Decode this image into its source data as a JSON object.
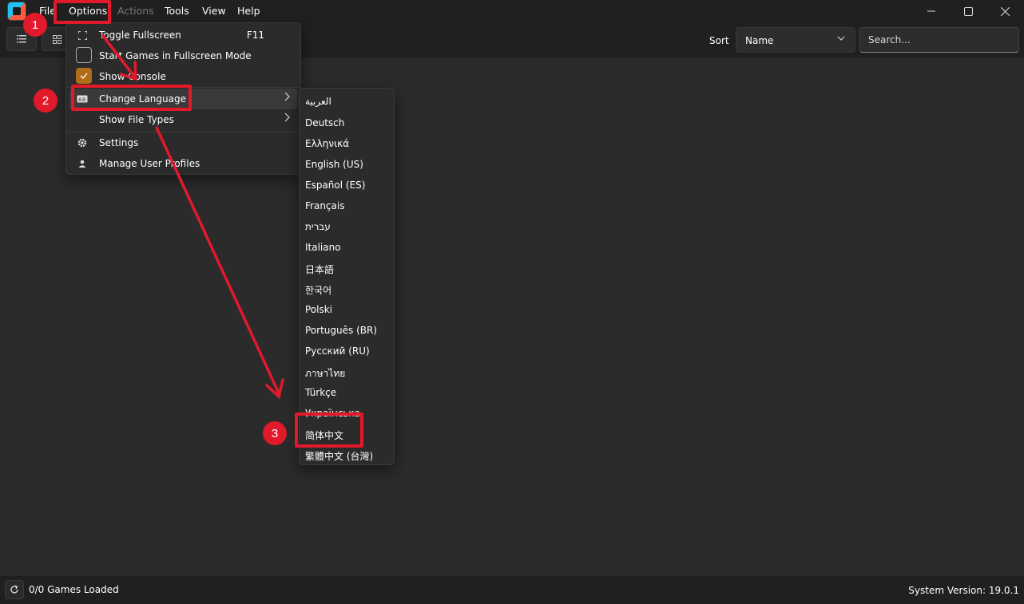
{
  "menubar": {
    "items": [
      {
        "label": "File",
        "x_note": ""
      },
      {
        "label": "Options"
      },
      {
        "label": "Actions",
        "disabled": true
      },
      {
        "label": "Tools"
      },
      {
        "label": "View"
      },
      {
        "label": "Help"
      }
    ]
  },
  "window_controls": {
    "minimize": "—",
    "maximize": "☐",
    "close": "✕"
  },
  "toolbar": {
    "list_view_icon": "list-icon",
    "grid_view_icon": "grid-icon",
    "sort_label": "Sort",
    "sort_value": "Name",
    "search_placeholder": "Search..."
  },
  "options_menu": {
    "items": [
      {
        "label": "Toggle Fullscreen",
        "shortcut": "F11",
        "icon": "fullscreen-icon"
      },
      {
        "label": "Start Games in Fullscreen Mode",
        "checkbox": false
      },
      {
        "label": "Show Console",
        "checkbox": true
      },
      {
        "label": "Change Language",
        "icon": "language-icon",
        "submenu": true
      },
      {
        "label": "Show File Types",
        "submenu": true
      },
      {
        "label": "Settings",
        "icon": "gear-icon"
      },
      {
        "label": "Manage User Profiles",
        "icon": "user-icon"
      }
    ]
  },
  "language_menu": {
    "items": [
      "العربية",
      "Deutsch",
      "Ελληνικά",
      "English (US)",
      "Español (ES)",
      "Français",
      "עברית",
      "Italiano",
      "日本語",
      "한국어",
      "Polski",
      "Português (BR)",
      "Русский (RU)",
      "ภาษาไทย",
      "Türkçe",
      "Українська",
      "简体中文",
      "繁體中文 (台灣)"
    ]
  },
  "status": {
    "games_loaded": "0/0 Games Loaded",
    "system_version": "System Version: 19.0.1"
  },
  "annotations": {
    "steps": [
      "1",
      "2",
      "3"
    ],
    "color": "#e0192b"
  }
}
